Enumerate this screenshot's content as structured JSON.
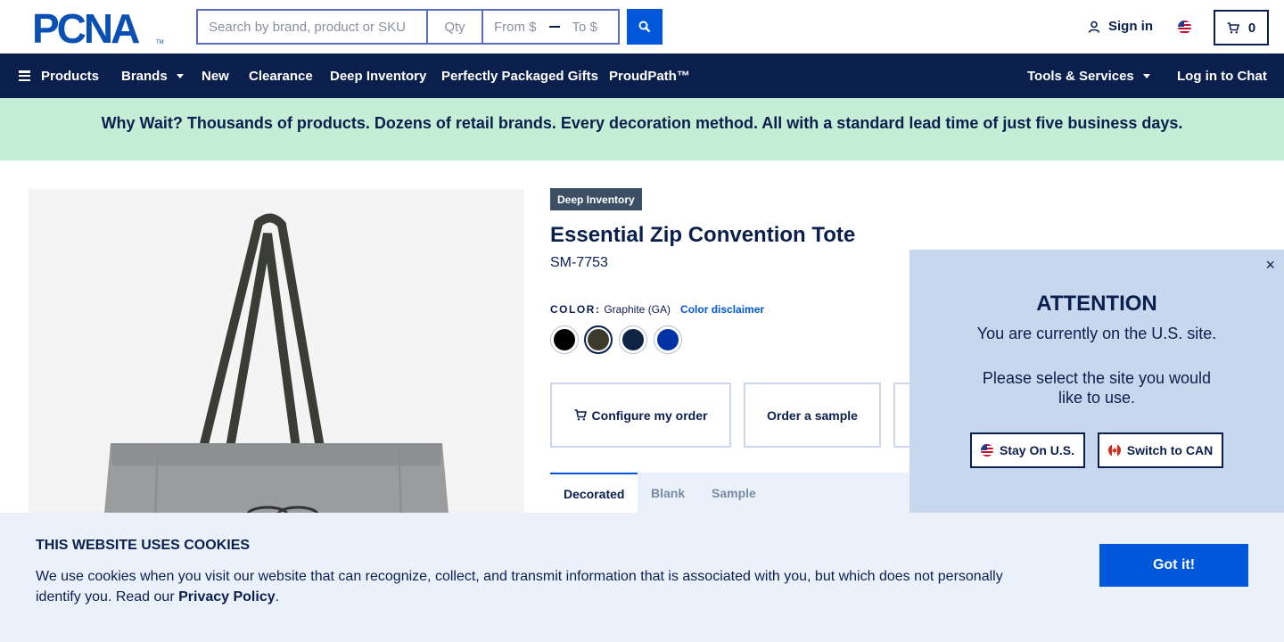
{
  "header": {
    "logo_text": "PCNA",
    "search_placeholder": "Search by brand, product or SKU",
    "qty_placeholder": "Qty",
    "price_from_placeholder": "From $",
    "price_to_placeholder": "To $",
    "signin_label": "Sign in",
    "cart_count": "0"
  },
  "nav": {
    "items": [
      {
        "label": "Products"
      },
      {
        "label": "Brands"
      },
      {
        "label": "New"
      },
      {
        "label": "Clearance"
      },
      {
        "label": "Deep Inventory"
      },
      {
        "label": "Perfectly Packaged Gifts"
      },
      {
        "label": "ProudPath™"
      },
      {
        "label": "Tools & Services"
      },
      {
        "label": "Log in to Chat"
      }
    ]
  },
  "banner": {
    "text": "Why Wait? Thousands of products. Dozens of retail brands. Every decoration method. All with a standard lead time of just five business days."
  },
  "product": {
    "badge": "Deep Inventory",
    "title": "Essential Zip Convention Tote",
    "sku": "SM-7753",
    "color_label": "COLOR:",
    "color_value": "Graphite (GA)",
    "color_disclaimer": "Color disclaimer",
    "swatches": [
      {
        "color": "#000000"
      },
      {
        "color": "#3b3a2c"
      },
      {
        "color": "#0f2444"
      },
      {
        "color": "#0033a6"
      }
    ],
    "actions": {
      "configure": "Configure my order",
      "sample": "Order a sample"
    },
    "tabs": [
      "Decorated",
      "Blank",
      "Sample"
    ]
  },
  "attention": {
    "title": "ATTENTION",
    "message1": "You are currently on the U.S. site.",
    "message2": "Please select the site you would like to use.",
    "stay_label": "Stay On U.S.",
    "switch_label": "Switch to CAN",
    "close": "×"
  },
  "cookie": {
    "title": "THIS WEBSITE USES COOKIES",
    "text_before": "We use cookies when you visit our website that can recognize, collect, and transmit information that is associated with you, but which does not personally identify you. Read our ",
    "link": "Privacy Policy",
    "text_after": ".",
    "button": "Got it!"
  },
  "colors": {
    "navy": "#0b1f4d",
    "brand_blue": "#0057d9",
    "banner_green": "#c4eed6",
    "popup_blue": "#c6d7ee",
    "cookie_bg": "#eaf1fb"
  }
}
